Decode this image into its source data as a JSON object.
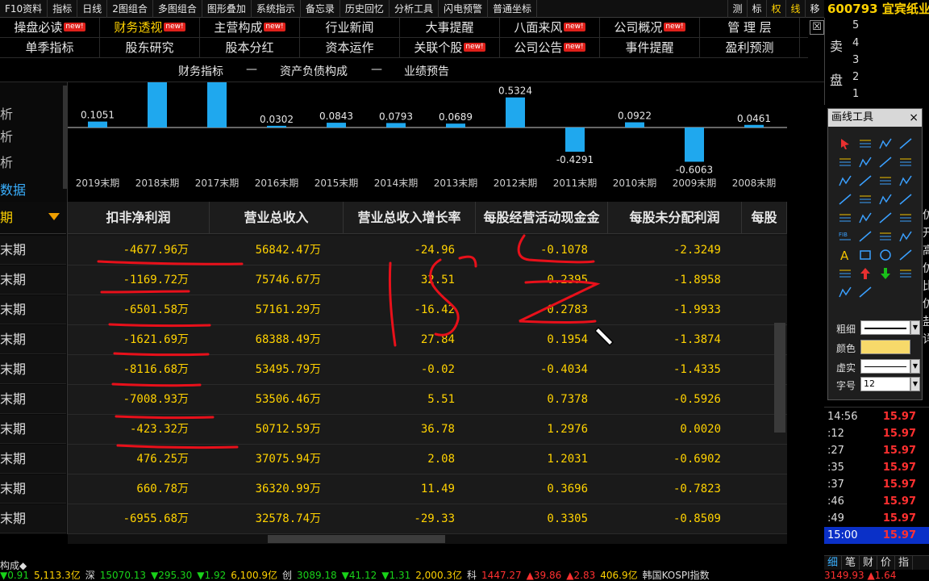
{
  "menubar": {
    "items": [
      "",
      "F10资料",
      "指标",
      "日线",
      "2图组合",
      "多图组合",
      "图形叠加",
      "系统指示",
      "备忘录",
      "历史回忆",
      "分析工具",
      "闪电预警",
      "普通坐标"
    ],
    "right": [
      "测",
      "标",
      "权",
      "线",
      "移"
    ]
  },
  "stock": {
    "code": "600793",
    "name": "宜宾纸业"
  },
  "f10nav": {
    "row1": [
      {
        "label": "操盘必读",
        "new": "new!"
      },
      {
        "label": "财务透视",
        "new": "new!"
      },
      {
        "label": "主营构成",
        "new": "new!"
      },
      {
        "label": "行业新闻",
        "new": ""
      },
      {
        "label": "大事提醒",
        "new": ""
      },
      {
        "label": "八面来风",
        "new": "new!"
      },
      {
        "label": "公司概况",
        "new": "new!"
      },
      {
        "label": "管 理 层",
        "new": ""
      }
    ],
    "row2": [
      {
        "label": "单季指标",
        "new": ""
      },
      {
        "label": "股东研究",
        "new": ""
      },
      {
        "label": "股本分红",
        "new": ""
      },
      {
        "label": "资本运作",
        "new": ""
      },
      {
        "label": "关联个股",
        "new": "new!"
      },
      {
        "label": "公司公告",
        "new": "new!"
      },
      {
        "label": "事件提醒",
        "new": ""
      },
      {
        "label": "盈利预测",
        "new": ""
      }
    ],
    "close": "☒"
  },
  "orderbook": {
    "side_sell_1": "卖",
    "side_sell_2": "盘",
    "levels": [
      "5",
      "4",
      "3",
      "2",
      "1"
    ]
  },
  "subtabs": {
    "a": "财务指标",
    "sep1": "—",
    "b": "资产负债构成",
    "sep2": "—",
    "c": "业绩预告"
  },
  "sidebar": {
    "items": [
      "析",
      "析",
      "析",
      "数据"
    ],
    "header": "期",
    "rows": [
      "末期",
      "末期",
      "末期",
      "末期",
      "末期",
      "末期",
      "末期",
      "末期",
      "末期",
      "末期"
    ]
  },
  "chart_data": {
    "type": "bar",
    "categories": [
      "2019末期",
      "2018末期",
      "2017末期",
      "2016末期",
      "2015末期",
      "2014末期",
      "2013末期",
      "2012末期",
      "2011末期",
      "2010末期",
      "2009末期",
      "2008末期"
    ],
    "values": [
      0.1051,
      1.3,
      0.93,
      0.0302,
      0.0843,
      0.0793,
      0.0689,
      0.5324,
      -0.4291,
      0.0922,
      -0.6063,
      0.0461
    ],
    "labels": [
      "0.1051",
      "",
      "",
      "0.0302",
      "0.0843",
      "0.0793",
      "0.0689",
      "0.5324",
      "-0.4291",
      "0.0922",
      "-0.6063",
      "0.0461"
    ],
    "colors": {
      "bar": "#1fa8ee",
      "axis": "#cccccc"
    }
  },
  "table": {
    "headers": [
      "扣非净利润",
      "营业总收入",
      "营业总收入增长率",
      "每股经营活动现金金",
      "每股未分配利润",
      "每股"
    ],
    "rows": [
      [
        "-4677.96万",
        "56842.47万",
        "-24.96",
        "-0.1078",
        "-2.3249"
      ],
      [
        "-1169.72万",
        "75746.67万",
        "32.51",
        "0.2395",
        "-1.8958"
      ],
      [
        "-6501.58万",
        "57161.29万",
        "-16.42",
        "-0.2783",
        "-1.9933"
      ],
      [
        "-1621.69万",
        "68388.49万",
        "27.84",
        "0.1954",
        "-1.3874"
      ],
      [
        "-8116.68万",
        "53495.79万",
        "-0.02",
        "-0.4034",
        "-1.4335"
      ],
      [
        "-7008.93万",
        "53506.46万",
        "5.51",
        "0.7378",
        "-0.5926"
      ],
      [
        "-423.32万",
        "50712.59万",
        "36.78",
        "1.2976",
        "0.0020"
      ],
      [
        "476.25万",
        "37075.94万",
        "2.08",
        "1.2031",
        "-0.6902"
      ],
      [
        "660.78万",
        "36320.99万",
        "11.49",
        "0.3696",
        "-0.7823"
      ],
      [
        "-6955.68万",
        "32578.74万",
        "-29.33",
        "0.3305",
        "-0.8509"
      ]
    ]
  },
  "draw_panel": {
    "title": "画线工具",
    "close": "×",
    "props": {
      "width_label": "粗细",
      "color_label": "颜色",
      "style_label": "虚实",
      "font_label": "字号",
      "font_value": "12",
      "color_value": "#f7d96a"
    }
  },
  "ticks": {
    "rows": [
      {
        "time": "14:56",
        "price": "15.97"
      },
      {
        "time": ":12",
        "price": "15.97"
      },
      {
        "time": ":27",
        "price": "15.97"
      },
      {
        "time": ":35",
        "price": "15.97"
      },
      {
        "time": ":37",
        "price": "15.97"
      },
      {
        "time": ":46",
        "price": "15.97"
      },
      {
        "time": ":49",
        "price": "15.97"
      },
      {
        "time": "15:00",
        "price": "15.97"
      }
    ],
    "tabs": [
      "细",
      "笔",
      "财",
      "价",
      "指"
    ]
  },
  "right_strip": [
    "仿",
    "开",
    "高",
    "仿",
    "比",
    "仿",
    "盐",
    "详"
  ],
  "bottom": {
    "left_text": "构成◆",
    "ticker": [
      {
        "t": "▼0.91",
        "c": "down"
      },
      {
        "t": "5,113.3亿",
        "c": "vol"
      },
      {
        "t": "深",
        "c": "idx"
      },
      {
        "t": "15070.13",
        "c": "down"
      },
      {
        "t": "▼295.30",
        "c": "down"
      },
      {
        "t": "▼1.92",
        "c": "down"
      },
      {
        "t": "6,100.9亿",
        "c": "vol"
      },
      {
        "t": "创",
        "c": "idx"
      },
      {
        "t": "3089.18",
        "c": "down"
      },
      {
        "t": "▼41.12",
        "c": "down"
      },
      {
        "t": "▼1.31",
        "c": "down"
      },
      {
        "t": "2,000.3亿",
        "c": "vol"
      },
      {
        "t": "科",
        "c": "idx"
      },
      {
        "t": "1447.27",
        "c": "up"
      },
      {
        "t": "▲39.86",
        "c": "up"
      },
      {
        "t": "▲2.83",
        "c": "up"
      },
      {
        "t": "406.9亿",
        "c": "vol"
      },
      {
        "t": "韩国KOSPI指数",
        "c": "idx"
      }
    ],
    "corner": "3149.93  ▲1.64"
  }
}
